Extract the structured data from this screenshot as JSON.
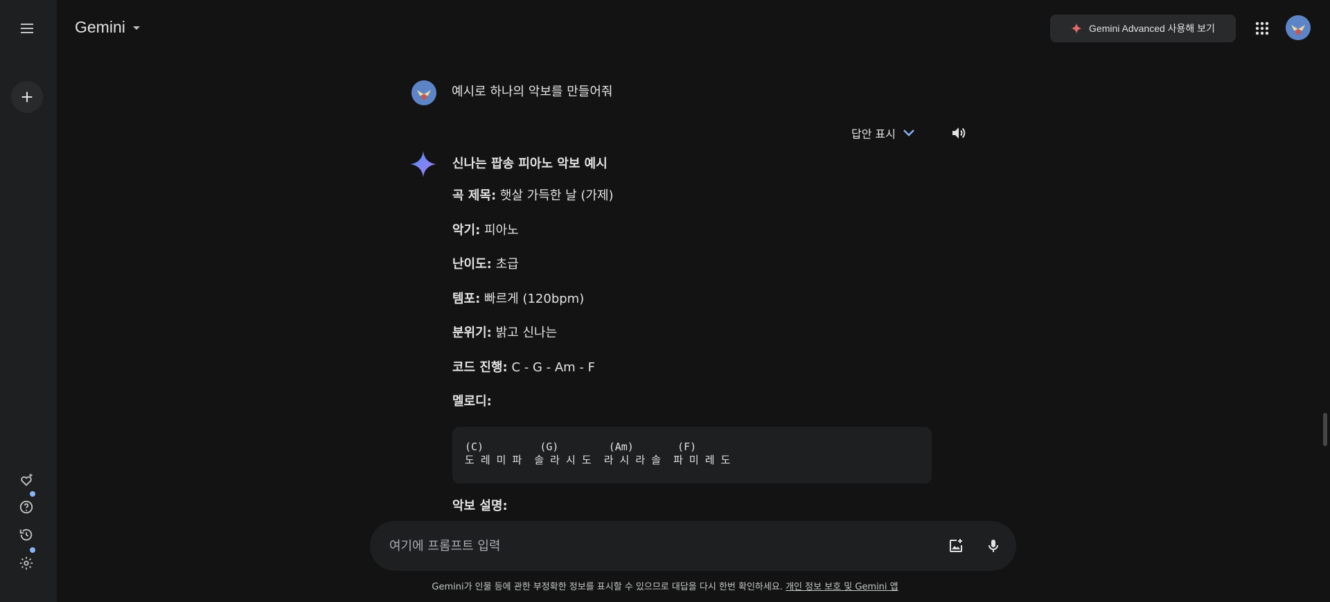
{
  "header": {
    "app_title": "Gemini",
    "upgrade_label": "Gemini Advanced 사용해 보기"
  },
  "icons": {
    "menu": "menu-icon",
    "new_chat": "plus-icon",
    "gem": "gem-sparkle-icon",
    "help": "help-icon",
    "activity": "history-icon",
    "settings": "gear-icon",
    "apps": "apps-grid-icon",
    "speaker": "speaker-icon",
    "image_upload": "add-image-icon",
    "mic": "mic-icon"
  },
  "conversation": {
    "user_message": "예시로 하나의 악보를 만들어줘",
    "drafts_label": "답안 표시",
    "response": {
      "title": "신나는 팝송 피아노 악보 예시",
      "fields": [
        {
          "label": "곡 제목:",
          "value": " 햇살 가득한 날 (가제)"
        },
        {
          "label": "악기:",
          "value": " 피아노"
        },
        {
          "label": "난이도:",
          "value": " 초급"
        },
        {
          "label": "템포:",
          "value": " 빠르게 (120bpm)"
        },
        {
          "label": "분위기:",
          "value": " 밝고 신나는"
        },
        {
          "label": "코드 진행:",
          "value": " C - G - Am - F"
        },
        {
          "label": "멜로디:",
          "value": ""
        }
      ],
      "code": "(C)         (G)        (Am)       (F)\n도 레 미 파  솔 라 시 도  라 시 라 솔  파 미 레 도",
      "trailing_label": "악보 설명:"
    }
  },
  "prompt": {
    "placeholder": "여기에 프롬프트 입력"
  },
  "footer": {
    "disclaimer": "Gemini가 인물 등에 관한 부정확한 정보를 표시할 수 있으므로 대답을 다시 한번 확인하세요. ",
    "privacy_link": "개인 정보 보호 및 Gemini 앱"
  },
  "colors": {
    "background": "#131314",
    "sidebar": "#1e1f20",
    "accent_blue": "#8ab4f8"
  }
}
